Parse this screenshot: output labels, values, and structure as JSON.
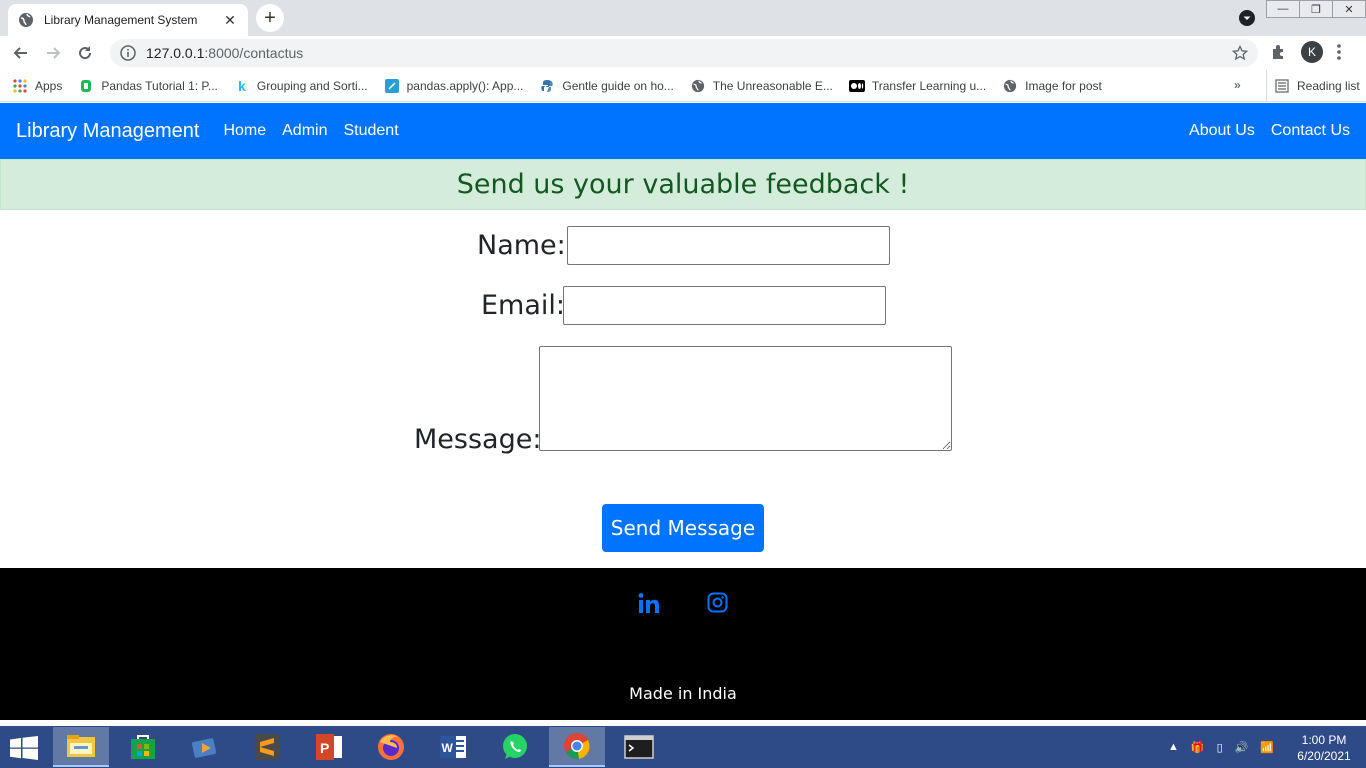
{
  "browser": {
    "tab_title": "Library Management System",
    "tab_close": "✕",
    "new_tab": "+",
    "url_host": "127.0.0.1",
    "url_rest": ":8000/contactus",
    "profile_initial": "K",
    "window_controls": [
      "—",
      "❐",
      "✕"
    ]
  },
  "bookmarks": {
    "items": [
      {
        "label": "Apps",
        "icon": "apps-grid-icon"
      },
      {
        "label": "Pandas Tutorial 1: P...",
        "icon": "pandas-icon"
      },
      {
        "label": "Grouping and Sorti...",
        "icon": "k-icon"
      },
      {
        "label": "pandas.apply(): App...",
        "icon": "code-icon"
      },
      {
        "label": "Gentle guide on ho...",
        "icon": "python-icon"
      },
      {
        "label": "The Unreasonable E...",
        "icon": "globe-icon"
      },
      {
        "label": "Transfer Learning u...",
        "icon": "medium-icon"
      },
      {
        "label": "Image for post",
        "icon": "globe-icon"
      }
    ],
    "more": "»",
    "reading_list": "Reading list"
  },
  "site_nav": {
    "brand": "Library Management",
    "left_links": [
      "Home",
      "Admin",
      "Student"
    ],
    "right_links": [
      "About Us",
      "Contact Us"
    ],
    "color": "#0074ff"
  },
  "alert": {
    "text": "Send us your valuable feedback !"
  },
  "form": {
    "name_label": "Name:",
    "email_label": "Email:",
    "message_label": "Message:",
    "name_value": "",
    "email_value": "",
    "message_value": "",
    "submit_label": "Send Message"
  },
  "footer": {
    "social": [
      "linkedin-icon",
      "instagram-icon"
    ],
    "made_in": "Made in India"
  },
  "taskbar": {
    "apps": [
      "file-explorer-icon",
      "store-icon",
      "media-icon",
      "sublime-icon",
      "powerpoint-icon",
      "firefox-icon",
      "word-icon",
      "whatsapp-icon",
      "chrome-icon",
      "terminal-icon"
    ],
    "time": "1:00 PM",
    "date": "6/20/2021"
  }
}
